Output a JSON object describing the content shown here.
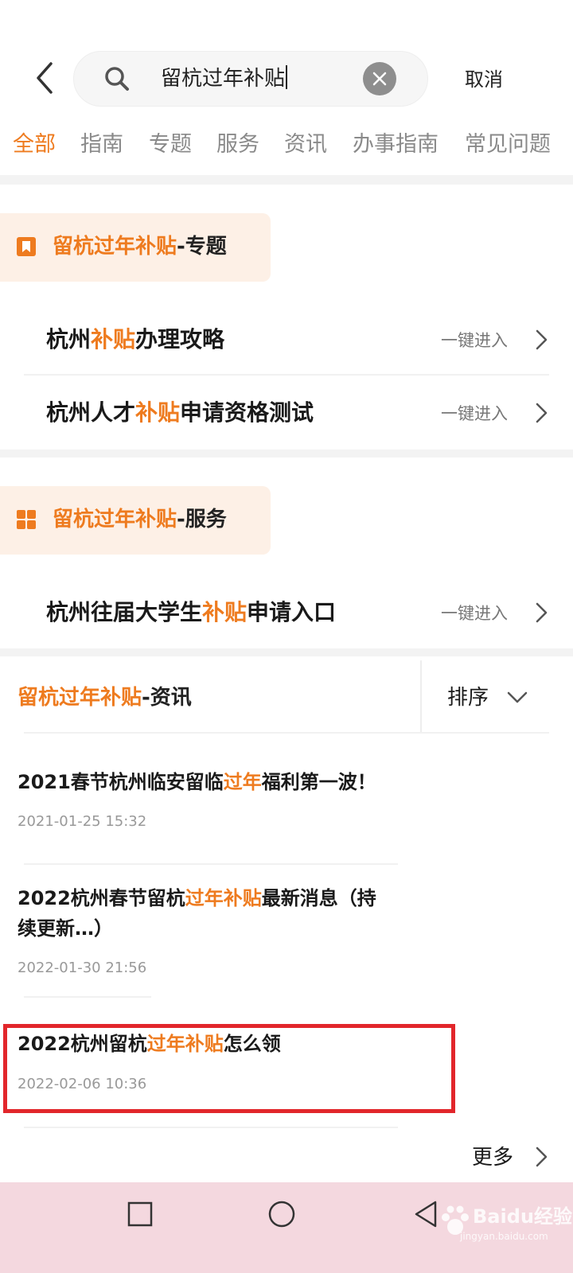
{
  "search": {
    "query": "留杭过年补贴",
    "cancel_label": "取消"
  },
  "tabs": [
    {
      "label": "全部",
      "active": true
    },
    {
      "label": "指南"
    },
    {
      "label": "专题"
    },
    {
      "label": "服务"
    },
    {
      "label": "资讯"
    },
    {
      "label": "办事指南"
    },
    {
      "label": "常见问题"
    }
  ],
  "topic_section": {
    "title_highlight": "留杭过年补贴",
    "title_suffix": "-专题",
    "icon": "bookmark-icon",
    "items": [
      {
        "pre": "杭州",
        "hl": "补贴",
        "post": "办理攻略",
        "action": "一键进入"
      },
      {
        "pre": "杭州人才",
        "hl": "补贴",
        "post": "申请资格测试",
        "action": "一键进入"
      }
    ]
  },
  "service_section": {
    "title_highlight": "留杭过年补贴",
    "title_suffix": "-服务",
    "icon": "grid-icon",
    "items": [
      {
        "pre": "杭州往届大学生",
        "hl": "补贴",
        "post": "申请入口",
        "action": "一键进入"
      }
    ]
  },
  "news_section": {
    "title_highlight": "留杭过年补贴",
    "title_suffix": "-资讯",
    "sort_label": "排序",
    "items": [
      {
        "pre": "2021春节杭州临安留临",
        "hl": "过年",
        "post": "福利第一波！",
        "date": "2021-01-25 15:32"
      },
      {
        "pre": "2022杭州春节留杭",
        "hl": "过年补贴",
        "post": "最新消息（持续更新…）",
        "date": "2022-01-30 21:56"
      },
      {
        "pre": "2022杭州留杭",
        "hl": "过年补贴",
        "post": "怎么领",
        "date": "2022-02-06 10:36"
      }
    ],
    "more_label": "更多"
  },
  "watermark": "Baidu经验 jingyan.baidu.com",
  "colors": {
    "accent": "#ee7b1f",
    "highlight_box": "#e2262b"
  }
}
